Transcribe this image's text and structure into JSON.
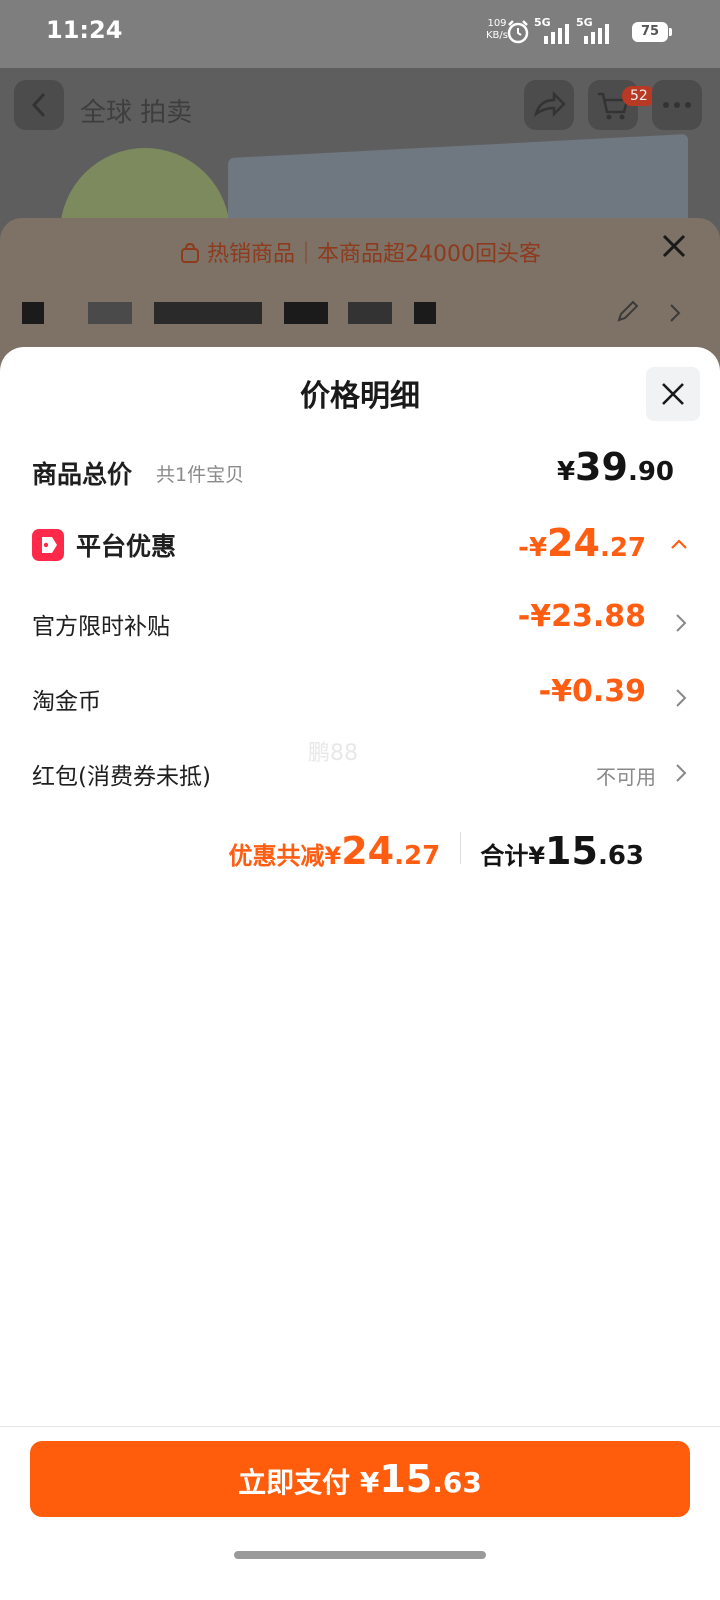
{
  "status": {
    "time": "11:24",
    "net_speed": "109",
    "net_unit": "KB/s",
    "signal1": "5G",
    "signal2": "5G",
    "battery": "75"
  },
  "background_page": {
    "title": "全球 拍卖",
    "cart_badge": "52"
  },
  "banner": {
    "text": "热销商品｜本商品超24000回头客"
  },
  "sheet": {
    "title": "价格明细",
    "total": {
      "label": "商品总价",
      "sub": "共1件宝贝",
      "currency": "¥",
      "int": "39",
      "dec": ".90"
    },
    "platform": {
      "label": "平台优惠",
      "prefix": "-¥",
      "int": "24",
      "dec": ".27"
    },
    "items": [
      {
        "label": "官方限时补贴",
        "value": "-¥23.88"
      },
      {
        "label": "淘金币",
        "value": "-¥0.39"
      },
      {
        "label": "红包(消费券未抵)",
        "value": "不可用"
      }
    ],
    "watermark": "鹏88",
    "summary": {
      "discount_label": "优惠共减¥",
      "discount_int": "24",
      "discount_dec": ".27",
      "total_label": "合计¥",
      "total_int": "15",
      "total_dec": ".63"
    }
  },
  "pay_button": {
    "label": "立即支付 ¥",
    "int": "15",
    "dec": ".63"
  },
  "colors": {
    "accent": "#ff5d12",
    "button": "#ff5c0b",
    "tag": "#ff2a4a"
  }
}
